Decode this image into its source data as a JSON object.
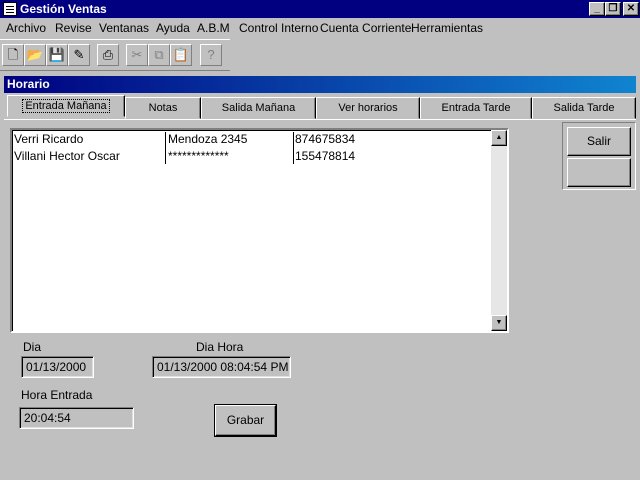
{
  "window": {
    "title": "Gestión Ventas"
  },
  "window_buttons": {
    "minimize": "_",
    "restore": "❐",
    "close": "✕"
  },
  "menu": [
    "Archivo",
    "Revise",
    "Ventanas",
    "Ayuda",
    "A.B.M",
    "Control Interno",
    "Cuenta Corriente",
    "Herramientas"
  ],
  "toolbar": {
    "icons": [
      "new-icon",
      "open-icon",
      "save-icon",
      "edit-icon",
      "print-icon",
      "cut-icon",
      "copy-icon",
      "paste-icon",
      "help-icon"
    ]
  },
  "form": {
    "title": "Horario",
    "tabs": [
      "Entrada Mañana",
      "Notas",
      "Salida Mañana",
      "Ver horarios",
      "Entrada Tarde",
      "Salida Tarde"
    ],
    "active_tab": "Entrada Mañana",
    "list": {
      "rows": [
        {
          "name": "Verri Ricardo",
          "address": "Mendoza 2345",
          "phone": "874675834"
        },
        {
          "name": "Villani Hector Oscar",
          "address": "*************",
          "phone": "155478814"
        }
      ]
    },
    "buttons": {
      "salir": "Salir",
      "blank": "",
      "grabar": "Grabar"
    },
    "dia": {
      "label": "Dia",
      "value": "01/13/2000"
    },
    "dia_hora": {
      "label": "Dia Hora",
      "value": "01/13/2000 08:04:54 PM"
    },
    "hora_entrada": {
      "label": "Hora Entrada",
      "value": "20:04:54"
    }
  }
}
